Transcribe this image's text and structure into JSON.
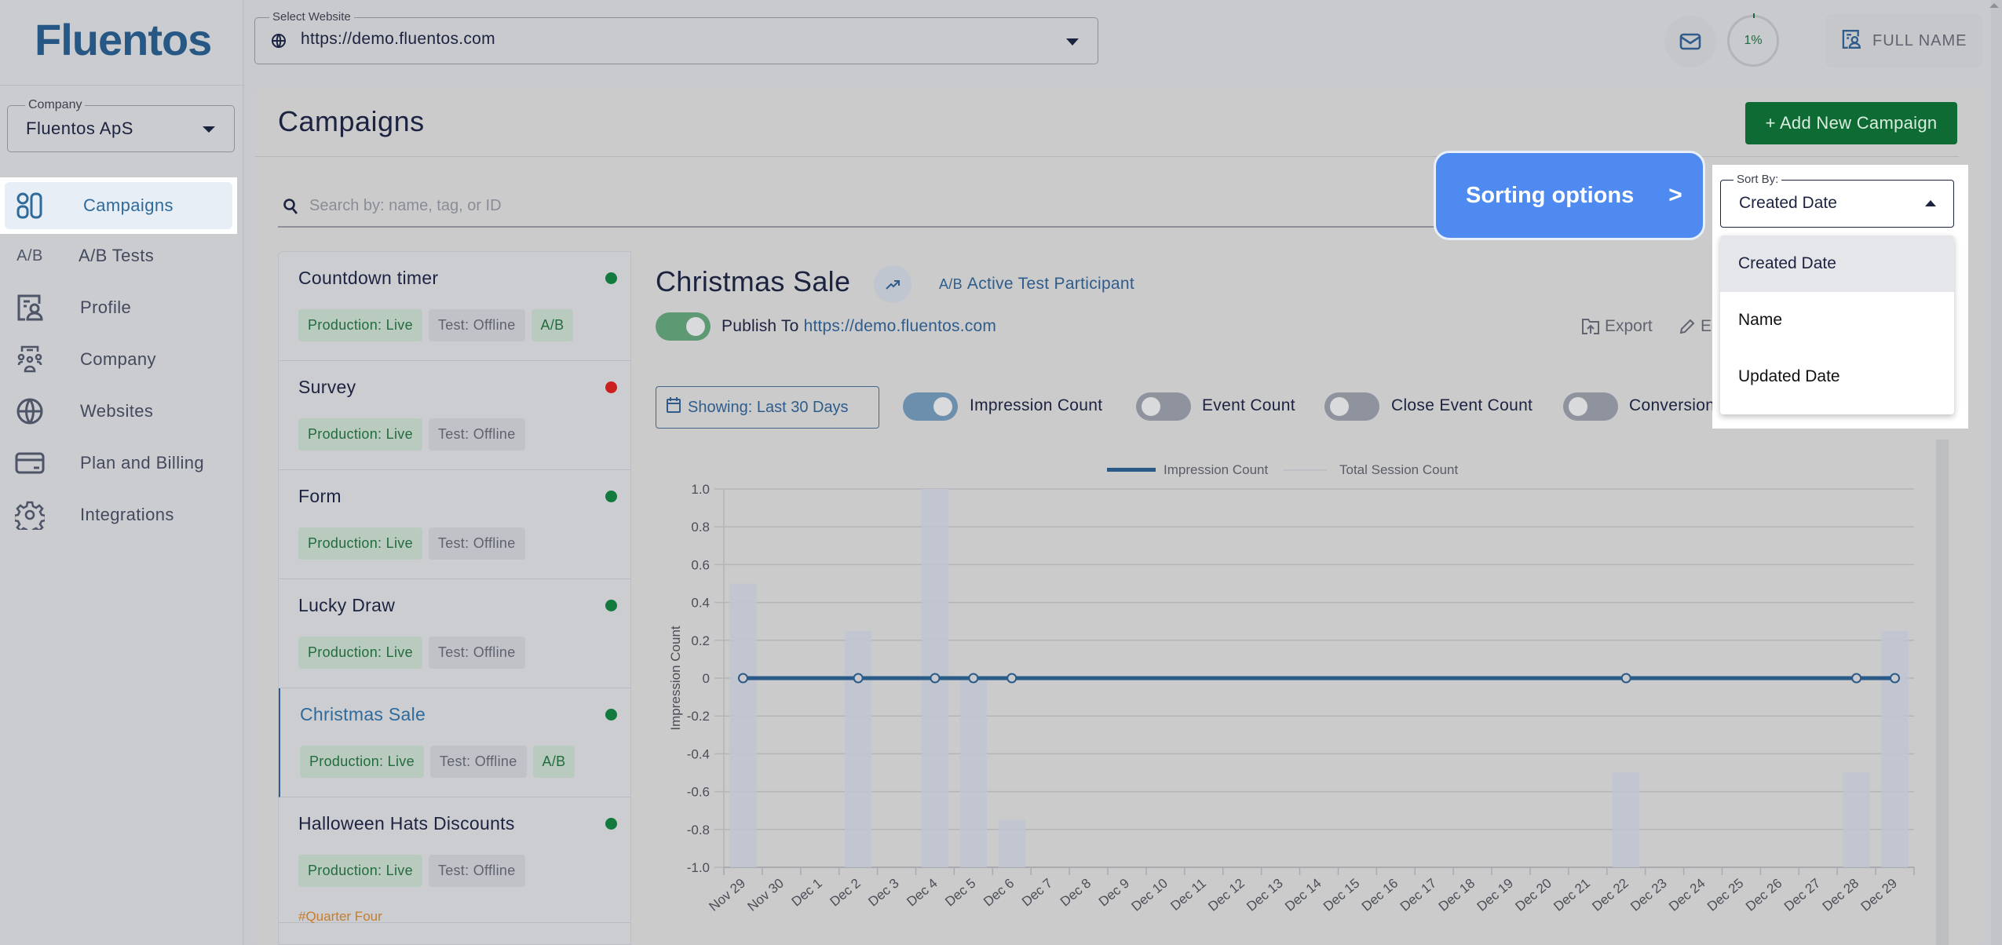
{
  "app": {
    "logo": "Fluentos"
  },
  "sidebar": {
    "company_label": "Company",
    "company_value": "Fluentos ApS",
    "items": [
      {
        "label": "Campaigns",
        "icon": "campaigns-icon",
        "active": true
      },
      {
        "label": "A/B Tests",
        "icon": "ab-tests-icon",
        "icon_text": "A/B"
      },
      {
        "label": "Profile",
        "icon": "profile-icon"
      },
      {
        "label": "Company",
        "icon": "company-icon"
      },
      {
        "label": "Websites",
        "icon": "globe-icon"
      },
      {
        "label": "Plan and Billing",
        "icon": "credit-card-icon"
      },
      {
        "label": "Integrations",
        "icon": "gear-icon"
      }
    ]
  },
  "header": {
    "website_label": "Select Website",
    "website_value": "https://demo.fluentos.com",
    "progress": "1%",
    "user_name": "FULL NAME"
  },
  "page": {
    "title": "Campaigns",
    "add_button": "+ Add New Campaign",
    "search_placeholder": "Search by: name, tag, or ID"
  },
  "sort": {
    "label": "Sort By:",
    "value": "Created Date",
    "options": [
      "Created Date",
      "Name",
      "Updated Date"
    ]
  },
  "callout": {
    "text": "Sorting options",
    "arrow": ">"
  },
  "campaigns": [
    {
      "name": "Countdown timer",
      "status_color": "#117a3c",
      "tags": [
        "Production: Live",
        "Test: Offline",
        "A/B"
      ]
    },
    {
      "name": "Survey",
      "status_color": "#cc1f1f",
      "tags": [
        "Production: Live",
        "Test: Offline"
      ]
    },
    {
      "name": "Form",
      "status_color": "#117a3c",
      "tags": [
        "Production: Live",
        "Test: Offline"
      ]
    },
    {
      "name": "Lucky Draw",
      "status_color": "#117a3c",
      "tags": [
        "Production: Live",
        "Test: Offline"
      ]
    },
    {
      "name": "Christmas Sale",
      "status_color": "#117a3c",
      "tags": [
        "Production: Live",
        "Test: Offline",
        "A/B"
      ],
      "selected": true
    },
    {
      "name": "Halloween Hats Discounts",
      "status_color": "#117a3c",
      "tags": [
        "Production: Live",
        "Test: Offline"
      ],
      "hashtag": "#Quarter Four"
    }
  ],
  "detail": {
    "title": "Christmas Sale",
    "ab_badge": "A/B",
    "ab_text": "Active Test Participant",
    "publish_prefix": "Publish To",
    "publish_url": "https://demo.fluentos.com",
    "export_label": "Export",
    "edit_label": "Ed",
    "date_range": "Showing: Last 30 Days",
    "metrics": [
      {
        "label": "Impression Count",
        "on": true
      },
      {
        "label": "Event Count",
        "on": false
      },
      {
        "label": "Close Event Count",
        "on": false
      },
      {
        "label": "Conversion",
        "on": false
      }
    ]
  },
  "chart_data": {
    "type": "bar",
    "title": "",
    "xlabel": "",
    "ylabel": "Impression Count",
    "ylim": [
      -1.0,
      1.0
    ],
    "yticks": [
      "1.0",
      "0.8",
      "0.6",
      "0.4",
      "0.2",
      "0",
      "-0.2",
      "-0.4",
      "-0.6",
      "-0.8",
      "-1.0"
    ],
    "grid": true,
    "legend_position": "top-center",
    "categories": [
      "Nov 29",
      "Nov 30",
      "Dec 1",
      "Dec 2",
      "Dec 3",
      "Dec 4",
      "Dec 5",
      "Dec 6",
      "Dec 7",
      "Dec 8",
      "Dec 9",
      "Dec 10",
      "Dec 11",
      "Dec 12",
      "Dec 13",
      "Dec 14",
      "Dec 15",
      "Dec 16",
      "Dec 17",
      "Dec 18",
      "Dec 19",
      "Dec 20",
      "Dec 21",
      "Dec 22",
      "Dec 23",
      "Dec 24",
      "Dec 25",
      "Dec 26",
      "Dec 27",
      "Dec 28",
      "Dec 29"
    ],
    "series": [
      {
        "name": "Impression Count",
        "kind": "line",
        "color": "#2a5a88",
        "values": [
          0,
          0,
          0,
          0,
          0,
          0,
          0,
          0,
          0,
          0,
          0,
          0,
          0,
          0,
          0,
          0,
          0,
          0,
          0,
          0,
          0,
          0,
          0,
          0,
          0,
          0,
          0,
          0,
          0,
          0,
          0
        ],
        "markers": [
          "Nov 29",
          "Dec 2",
          "Dec 4",
          "Dec 5",
          "Dec 6",
          "Dec 22",
          "Dec 28",
          "Dec 29"
        ]
      },
      {
        "name": "Total Session Count",
        "kind": "bar",
        "color": "#bfc5d1",
        "values": [
          0.5,
          null,
          null,
          0.25,
          null,
          1.0,
          0,
          -0.75,
          null,
          null,
          null,
          null,
          null,
          null,
          null,
          null,
          null,
          null,
          null,
          null,
          null,
          null,
          null,
          -0.5,
          null,
          null,
          null,
          null,
          null,
          -0.5,
          0.25
        ]
      }
    ]
  }
}
